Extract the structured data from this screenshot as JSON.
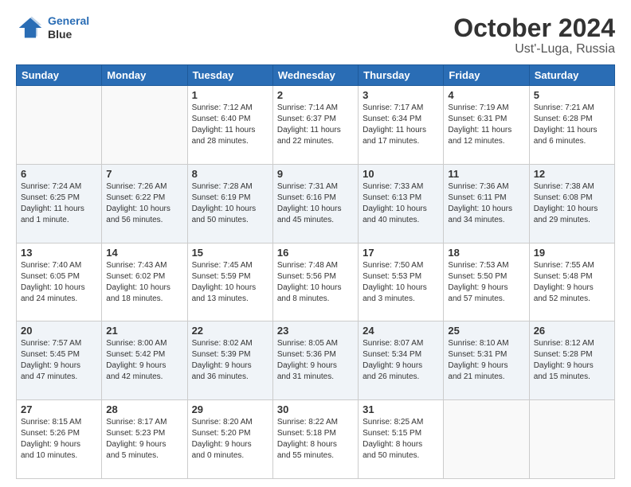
{
  "header": {
    "logo_line1": "General",
    "logo_line2": "Blue",
    "month": "October 2024",
    "location": "Ust'-Luga, Russia"
  },
  "weekdays": [
    "Sunday",
    "Monday",
    "Tuesday",
    "Wednesday",
    "Thursday",
    "Friday",
    "Saturday"
  ],
  "weeks": [
    [
      {
        "day": "",
        "text": ""
      },
      {
        "day": "",
        "text": ""
      },
      {
        "day": "1",
        "text": "Sunrise: 7:12 AM\nSunset: 6:40 PM\nDaylight: 11 hours\nand 28 minutes."
      },
      {
        "day": "2",
        "text": "Sunrise: 7:14 AM\nSunset: 6:37 PM\nDaylight: 11 hours\nand 22 minutes."
      },
      {
        "day": "3",
        "text": "Sunrise: 7:17 AM\nSunset: 6:34 PM\nDaylight: 11 hours\nand 17 minutes."
      },
      {
        "day": "4",
        "text": "Sunrise: 7:19 AM\nSunset: 6:31 PM\nDaylight: 11 hours\nand 12 minutes."
      },
      {
        "day": "5",
        "text": "Sunrise: 7:21 AM\nSunset: 6:28 PM\nDaylight: 11 hours\nand 6 minutes."
      }
    ],
    [
      {
        "day": "6",
        "text": "Sunrise: 7:24 AM\nSunset: 6:25 PM\nDaylight: 11 hours\nand 1 minute."
      },
      {
        "day": "7",
        "text": "Sunrise: 7:26 AM\nSunset: 6:22 PM\nDaylight: 10 hours\nand 56 minutes."
      },
      {
        "day": "8",
        "text": "Sunrise: 7:28 AM\nSunset: 6:19 PM\nDaylight: 10 hours\nand 50 minutes."
      },
      {
        "day": "9",
        "text": "Sunrise: 7:31 AM\nSunset: 6:16 PM\nDaylight: 10 hours\nand 45 minutes."
      },
      {
        "day": "10",
        "text": "Sunrise: 7:33 AM\nSunset: 6:13 PM\nDaylight: 10 hours\nand 40 minutes."
      },
      {
        "day": "11",
        "text": "Sunrise: 7:36 AM\nSunset: 6:11 PM\nDaylight: 10 hours\nand 34 minutes."
      },
      {
        "day": "12",
        "text": "Sunrise: 7:38 AM\nSunset: 6:08 PM\nDaylight: 10 hours\nand 29 minutes."
      }
    ],
    [
      {
        "day": "13",
        "text": "Sunrise: 7:40 AM\nSunset: 6:05 PM\nDaylight: 10 hours\nand 24 minutes."
      },
      {
        "day": "14",
        "text": "Sunrise: 7:43 AM\nSunset: 6:02 PM\nDaylight: 10 hours\nand 18 minutes."
      },
      {
        "day": "15",
        "text": "Sunrise: 7:45 AM\nSunset: 5:59 PM\nDaylight: 10 hours\nand 13 minutes."
      },
      {
        "day": "16",
        "text": "Sunrise: 7:48 AM\nSunset: 5:56 PM\nDaylight: 10 hours\nand 8 minutes."
      },
      {
        "day": "17",
        "text": "Sunrise: 7:50 AM\nSunset: 5:53 PM\nDaylight: 10 hours\nand 3 minutes."
      },
      {
        "day": "18",
        "text": "Sunrise: 7:53 AM\nSunset: 5:50 PM\nDaylight: 9 hours\nand 57 minutes."
      },
      {
        "day": "19",
        "text": "Sunrise: 7:55 AM\nSunset: 5:48 PM\nDaylight: 9 hours\nand 52 minutes."
      }
    ],
    [
      {
        "day": "20",
        "text": "Sunrise: 7:57 AM\nSunset: 5:45 PM\nDaylight: 9 hours\nand 47 minutes."
      },
      {
        "day": "21",
        "text": "Sunrise: 8:00 AM\nSunset: 5:42 PM\nDaylight: 9 hours\nand 42 minutes."
      },
      {
        "day": "22",
        "text": "Sunrise: 8:02 AM\nSunset: 5:39 PM\nDaylight: 9 hours\nand 36 minutes."
      },
      {
        "day": "23",
        "text": "Sunrise: 8:05 AM\nSunset: 5:36 PM\nDaylight: 9 hours\nand 31 minutes."
      },
      {
        "day": "24",
        "text": "Sunrise: 8:07 AM\nSunset: 5:34 PM\nDaylight: 9 hours\nand 26 minutes."
      },
      {
        "day": "25",
        "text": "Sunrise: 8:10 AM\nSunset: 5:31 PM\nDaylight: 9 hours\nand 21 minutes."
      },
      {
        "day": "26",
        "text": "Sunrise: 8:12 AM\nSunset: 5:28 PM\nDaylight: 9 hours\nand 15 minutes."
      }
    ],
    [
      {
        "day": "27",
        "text": "Sunrise: 8:15 AM\nSunset: 5:26 PM\nDaylight: 9 hours\nand 10 minutes."
      },
      {
        "day": "28",
        "text": "Sunrise: 8:17 AM\nSunset: 5:23 PM\nDaylight: 9 hours\nand 5 minutes."
      },
      {
        "day": "29",
        "text": "Sunrise: 8:20 AM\nSunset: 5:20 PM\nDaylight: 9 hours\nand 0 minutes."
      },
      {
        "day": "30",
        "text": "Sunrise: 8:22 AM\nSunset: 5:18 PM\nDaylight: 8 hours\nand 55 minutes."
      },
      {
        "day": "31",
        "text": "Sunrise: 8:25 AM\nSunset: 5:15 PM\nDaylight: 8 hours\nand 50 minutes."
      },
      {
        "day": "",
        "text": ""
      },
      {
        "day": "",
        "text": ""
      }
    ]
  ]
}
